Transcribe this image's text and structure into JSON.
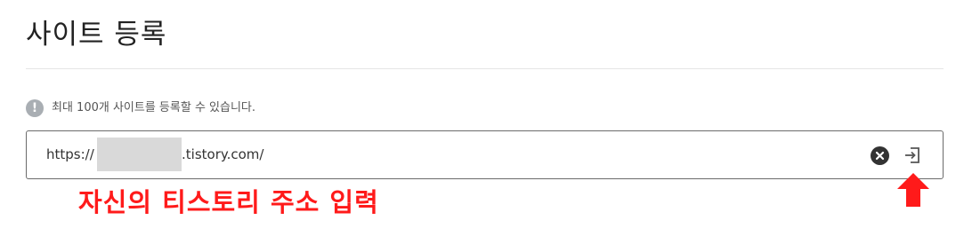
{
  "page": {
    "title": "사이트 등록"
  },
  "notice": {
    "icon": "info-icon",
    "icon_glyph": "!",
    "text": "최대 100개 사이트를 등록할 수 있습니다."
  },
  "url_input": {
    "prefix": "https://",
    "suffix": ".tistory.com/",
    "clear_icon": "close-circle-icon",
    "submit_icon": "enter-icon"
  },
  "annotation": {
    "text": "자신의 티스토리 주소 입력",
    "arrow_icon": "red-up-arrow-icon",
    "color": "#ff1a1a"
  }
}
